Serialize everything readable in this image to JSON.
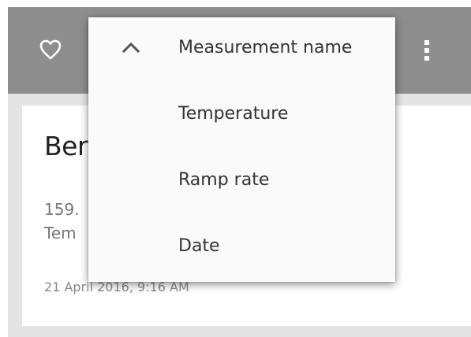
{
  "toolbar": {
    "background": "#8e8e8e",
    "favorite_icon": "heart-outline-icon",
    "overflow_icon": "more-vert-icon"
  },
  "card": {
    "title": "Ber",
    "line1": "159.",
    "line2": "Tem",
    "date": "21 April 2016, 9:16 AM"
  },
  "sort_menu": {
    "items": [
      {
        "label": "Measurement name",
        "selected": true,
        "indicator_icon": "chevron-up-icon"
      },
      {
        "label": "Temperature"
      },
      {
        "label": "Ramp rate"
      },
      {
        "label": "Date"
      }
    ]
  }
}
